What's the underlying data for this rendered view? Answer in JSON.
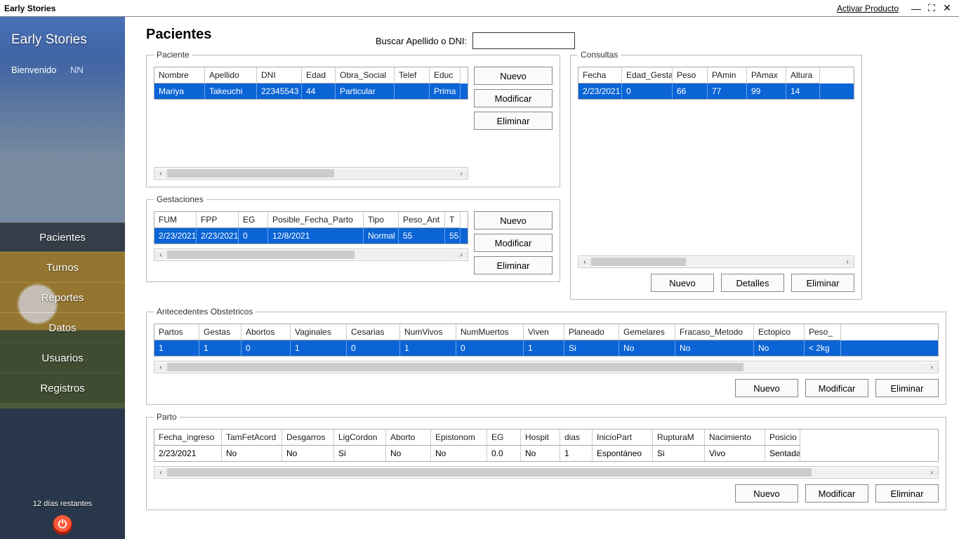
{
  "titlebar": {
    "title": "Early Stories",
    "activate": "Activar Producto"
  },
  "sidebar": {
    "brand": "Early Stories",
    "welcome": "Bienvenido",
    "user": "NN",
    "items": [
      "Pacientes",
      "Turnos",
      "Reportes",
      "Datos",
      "Usuarios",
      "Registros"
    ],
    "trial": "12 días restantes"
  },
  "page": {
    "title": "Pacientes",
    "search_label": "Buscar Apellido o DNI:",
    "search_value": ""
  },
  "buttons": {
    "nuevo": "Nuevo",
    "modificar": "Modificar",
    "eliminar": "Eliminar",
    "detalles": "Detalles"
  },
  "paciente": {
    "legend": "Paciente",
    "headers": [
      "Nombre",
      "Apellido",
      "DNI",
      "Edad",
      "Obra_Social",
      "Telef",
      "Educ"
    ],
    "row": [
      "Mariya",
      "Takeuchi",
      "22345543",
      "44",
      "Particular",
      "",
      "Prima"
    ]
  },
  "gestaciones": {
    "legend": "Gestaciones",
    "headers": [
      "FUM",
      "FPP",
      "EG",
      "Posible_Fecha_Parto",
      "Tipo",
      "Peso_Ant",
      "T"
    ],
    "row": [
      "2/23/2021",
      "2/23/2021",
      "0",
      "12/8/2021",
      "Normal",
      "55",
      "55"
    ]
  },
  "consultas": {
    "legend": "Consultas",
    "headers": [
      "Fecha",
      "Edad_Gesta",
      "Peso",
      "PAmin",
      "PAmax",
      "Altura"
    ],
    "row": [
      "2/23/2021",
      "0",
      "66",
      "77",
      "99",
      "14"
    ]
  },
  "antecedentes": {
    "legend": "Antecedentes Obstetricos",
    "headers": [
      "Partos",
      "Gestas",
      "Abortos",
      "Vaginales",
      "Cesarias",
      "NumVivos",
      "NumMuertos",
      "Viven",
      "Planeado",
      "Gemelares",
      "Fracaso_Metodo",
      "Ectopico",
      "Peso_"
    ],
    "row": [
      "1",
      "1",
      "0",
      "1",
      "0",
      "1",
      "0",
      "1",
      "Si",
      "No",
      "No",
      "No",
      "< 2kg"
    ]
  },
  "parto": {
    "legend": "Parto",
    "headers": [
      "Fecha_ingreso",
      "TamFetAcord",
      "Desgarros",
      "LigCordon",
      "Aborto",
      "Epistonom",
      "EG",
      "Hospit",
      "dias",
      "InicioPart",
      "RupturaM",
      "Nacimiento",
      "Posicio"
    ],
    "row": [
      "2/23/2021",
      "No",
      "No",
      "Si",
      "No",
      "No",
      "0.0",
      "No",
      "1",
      "Espontáneo",
      "Si",
      "Vivo",
      "Sentada"
    ]
  }
}
